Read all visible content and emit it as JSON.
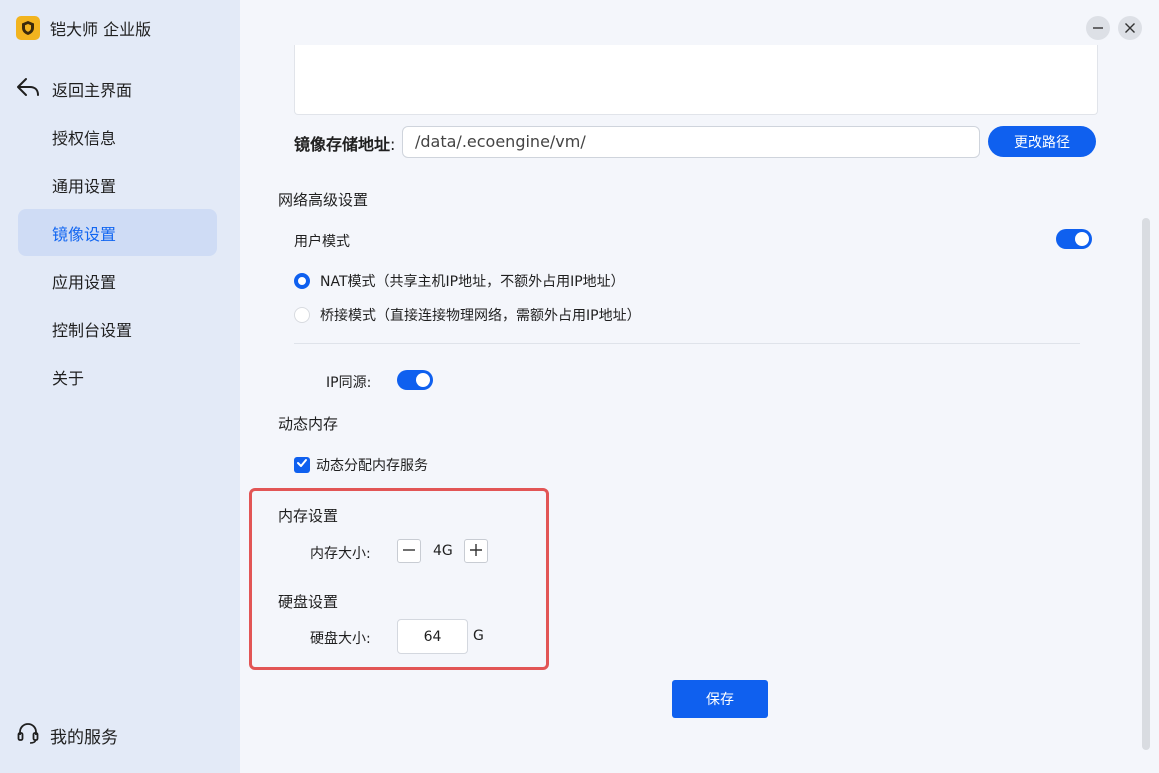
{
  "sidebar": {
    "brand": "铠大师 企业版",
    "back": "返回主界面",
    "items": [
      {
        "label": "授权信息"
      },
      {
        "label": "通用设置"
      },
      {
        "label": "镜像设置"
      },
      {
        "label": "应用设置"
      },
      {
        "label": "控制台设置"
      },
      {
        "label": "关于"
      }
    ],
    "active_index": 2,
    "service": "我的服务"
  },
  "main": {
    "image_path": {
      "label": "镜像存储地址",
      "colon": ":",
      "value": "/data/.ecoengine/vm/",
      "change_button": "更改路径"
    },
    "network": {
      "title": "网络高级设置",
      "user_mode_label": "用户模式",
      "user_mode_enabled": true,
      "nat_option": "NAT模式（共享主机IP地址，不额外占用IP地址）",
      "bridge_option": "桥接模式（直接连接物理网络，需额外占用IP地址）",
      "selected": "nat",
      "ip_same_source_label": "IP同源:",
      "ip_same_source_enabled": true
    },
    "dynamic_memory": {
      "title": "动态内存",
      "checkbox_label": "动态分配内存服务",
      "checked": true
    },
    "memory": {
      "title": "内存设置",
      "size_label": "内存大小:",
      "value": "4G"
    },
    "disk": {
      "title": "硬盘设置",
      "size_label": "硬盘大小:",
      "value": "64",
      "unit": "G"
    },
    "save_button": "保存"
  },
  "colors": {
    "accent": "#0f60ef",
    "sidebar_bg": "#e3eaf7",
    "active_bg": "#cfdcf5",
    "highlight": "#e25555"
  }
}
